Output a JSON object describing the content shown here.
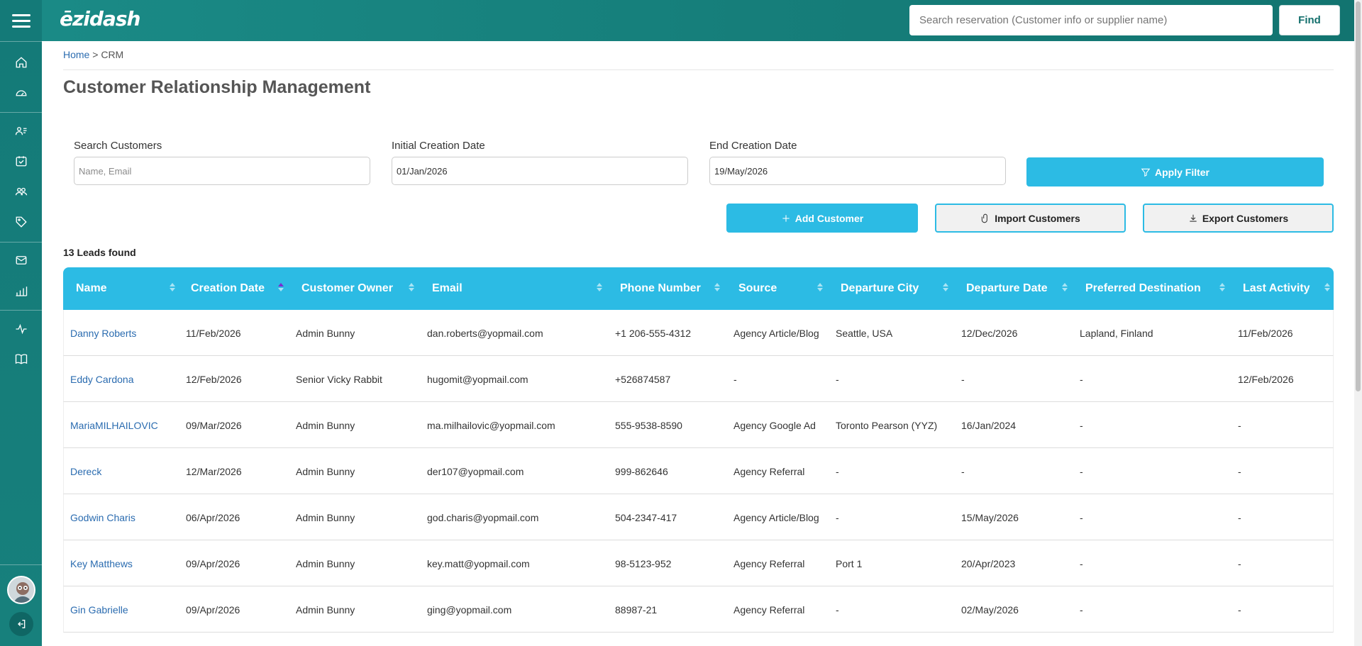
{
  "app": {
    "logo": "ēzidash"
  },
  "topbar": {
    "search_placeholder": "Search reservation (Customer info or supplier name)",
    "find_label": "Find"
  },
  "breadcrumb": {
    "home": "Home",
    "separator": " > ",
    "current": "CRM"
  },
  "page": {
    "title": "Customer Relationship Management"
  },
  "filters": {
    "search_label": "Search Customers",
    "search_placeholder": "Name, Email",
    "initial_date_label": "Initial Creation Date",
    "initial_date_value": "01/Jan/2026",
    "end_date_label": "End Creation Date",
    "end_date_value": "19/May/2026",
    "apply_label": "Apply Filter"
  },
  "actions": {
    "add_label": "Add Customer",
    "import_label": "Import Customers",
    "export_label": "Export Customers"
  },
  "results": {
    "count_text": "13 Leads found"
  },
  "table": {
    "columns": [
      "Name",
      "Creation Date",
      "Customer Owner",
      "Email",
      "Phone Number",
      "Source",
      "Departure City",
      "Departure Date",
      "Preferred Destination",
      "Last Activity"
    ],
    "sorted_column": "Creation Date",
    "rows": [
      [
        "Danny Roberts",
        "11/Feb/2026",
        "Admin Bunny",
        "dan.roberts@yopmail.com",
        "+1 206-555-4312",
        "Agency Article/Blog",
        "Seattle, USA",
        "12/Dec/2026",
        "Lapland, Finland",
        "11/Feb/2026"
      ],
      [
        "Eddy Cardona",
        "12/Feb/2026",
        "Senior Vicky Rabbit",
        "hugomit@yopmail.com",
        "+526874587",
        "-",
        "-",
        "-",
        "-",
        "12/Feb/2026"
      ],
      [
        "MariaMILHAILOVIC",
        "09/Mar/2026",
        "Admin Bunny",
        "ma.milhailovic@yopmail.com",
        "555-9538-8590",
        "Agency Google Ad",
        "Toronto Pearson (YYZ)",
        "16/Jan/2024",
        "-",
        "-"
      ],
      [
        "Dereck",
        "12/Mar/2026",
        "Admin Bunny",
        "der107@yopmail.com",
        "999-862646",
        "Agency Referral",
        "-",
        "-",
        "-",
        "-"
      ],
      [
        "Godwin Charis",
        "06/Apr/2026",
        "Admin Bunny",
        "god.charis@yopmail.com",
        "504-2347-417",
        "Agency Article/Blog",
        "-",
        "15/May/2026",
        "-",
        "-"
      ],
      [
        "Key Matthews",
        "09/Apr/2026",
        "Admin Bunny",
        "key.matt@yopmail.com",
        "98-5123-952",
        "Agency Referral",
        "Port 1",
        "20/Apr/2023",
        "-",
        "-"
      ],
      [
        "Gin Gabrielle",
        "09/Apr/2026",
        "Admin Bunny",
        "ging@yopmail.com",
        "88987-21",
        "Agency Referral",
        "-",
        "02/May/2026",
        "-",
        "-"
      ]
    ]
  },
  "sidebar": {
    "icons": [
      "home-icon",
      "dashboard-icon",
      "contacts-icon",
      "calendar-check-icon",
      "users-icon",
      "tag-icon",
      "mail-icon",
      "bar-chart-icon",
      "activity-icon",
      "book-icon"
    ]
  },
  "colors": {
    "primary": "#2cbbe4",
    "sidebar": "#147a78",
    "link": "#2b6cb0"
  }
}
